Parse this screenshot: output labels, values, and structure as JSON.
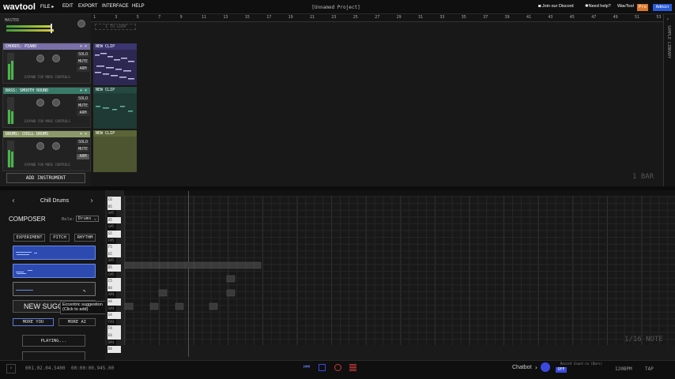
{
  "topbar": {
    "logo": "wavtool",
    "menus": [
      "FILE ▸",
      "EDIT",
      "EXPORT",
      "INTERFACE",
      "HELP"
    ],
    "project_name": "[Unnamed Project]",
    "discord": "Join our Discord",
    "help": "Need help?",
    "wavtool": "WavTool",
    "pro": "Pro",
    "admin": "Admin"
  },
  "master": {
    "label": "MASTER"
  },
  "arrangement": {
    "ruler": [
      "1",
      "3",
      "5",
      "7",
      "9",
      "11",
      "13",
      "15",
      "17",
      "19",
      "21",
      "23",
      "25",
      "27",
      "29",
      "31",
      "33",
      "35",
      "37",
      "39",
      "41",
      "43",
      "45",
      "47",
      "49",
      "51",
      "53"
    ],
    "loop_label": "1 TO LOOP",
    "scale_label": "1 BAR",
    "side_label": "SAMPLE LIBRARY",
    "add_instrument": "ADD INSTRUMENT"
  },
  "tracks": [
    {
      "name": "CHORDS: PIANO",
      "color": "#7a6fa8",
      "solo": "SOLO",
      "mute": "MUTE",
      "arm": "ARM",
      "expand": "EXPAND FOR MORE CONTROLS",
      "clip": "NEW CLIP",
      "clip_color": "#3b3570"
    },
    {
      "name": "BASS: SMOOTH ROUND",
      "color": "#3a7a68",
      "solo": "SOLO",
      "mute": "MUTE",
      "arm": "ARM",
      "expand": "EXPAND FOR MORE CONTROLS",
      "clip": "NEW CLIP",
      "clip_color": "#244a40"
    },
    {
      "name": "DRUMS: CHILL DRUMS",
      "color": "#8c9a6a",
      "solo": "SOLO",
      "mute": "MUTE",
      "arm": "ARM",
      "expand": "EXPAND FOR MORE CONTROLS",
      "clip": "NEW CLIP",
      "clip_color": "#5a6436"
    }
  ],
  "composer": {
    "instrument": "Chill Drums",
    "title": "COMPOSER",
    "role_label": "Role:",
    "role_value": "Drums",
    "tabs": [
      "EXPERIMENT",
      "PITCH",
      "RHYTHM"
    ],
    "new_suggestion": "NEW SUGGE",
    "tooltip_line1": "Eccentric suggestion",
    "tooltip_line2": "(Click to add)",
    "more_you": "MORE YOU",
    "more_ai": "MORE AI",
    "playing": "PLAYING..."
  },
  "piano_keys": [
    "C6",
    "B5",
    "A#5",
    "A5",
    "G#5",
    "G5",
    "F#5",
    "F5",
    "E5",
    "D#5",
    "D5",
    "C#5",
    "C5",
    "B4",
    "A#4",
    "A4",
    "G#4",
    "G4",
    "F#4",
    "F4",
    "E4",
    "D#4",
    "D4"
  ],
  "roll": {
    "grid_label": "1/16 NOTE"
  },
  "bottom": {
    "time1": "001.02.04.5400",
    "time2": "00:00:00.945.00",
    "chatbot": "Chatbot",
    "count_in": "Record Count-in (Bars)",
    "off": "OFF",
    "bpm": "120BPM",
    "tap": "TAP"
  },
  "colors": {
    "accent": "#2a5bd6",
    "pro": "#d9772b",
    "meter": "#4bb34b"
  }
}
